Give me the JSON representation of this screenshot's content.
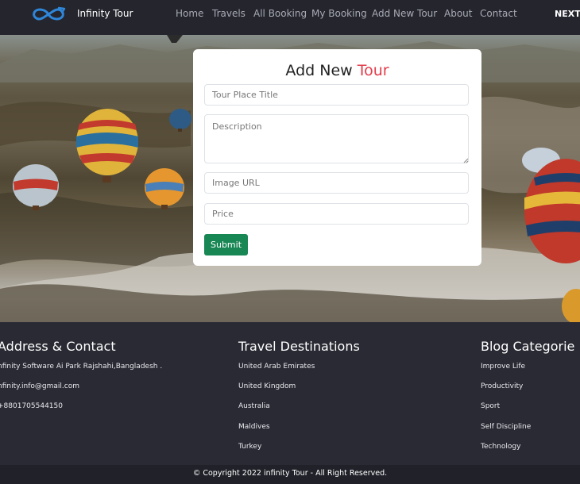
{
  "navbar": {
    "brand": "Infinity Tour",
    "links": [
      "Home",
      "Travels",
      "All Booking",
      "My Booking",
      "Add New Tour",
      "About",
      "Contact"
    ],
    "next_label": "NEXT C"
  },
  "form": {
    "title_main": "Add New ",
    "title_accent": "Tour",
    "tour_place_placeholder": "Tour Place Title",
    "description_placeholder": "Description",
    "image_url_placeholder": "Image URL",
    "price_placeholder": "Price",
    "submit_label": "Submit"
  },
  "footer": {
    "address": {
      "heading": "Address & Contact",
      "items": [
        "nfinity Software Ai Park Rajshahi,Bangladesh .",
        "nfinity.info@gmail.com",
        "+8801705544150"
      ]
    },
    "destinations": {
      "heading": "Travel Destinations",
      "items": [
        "United Arab Emirates",
        "United Kingdom",
        "Australia",
        "Maldives",
        "Turkey"
      ]
    },
    "blog": {
      "heading": "Blog Categorie",
      "items": [
        "Improve Life",
        "Productivity",
        "Sport",
        "Self Discipline",
        "Technology"
      ]
    },
    "copyright": "© Copyright 2022 infinity Tour - All Right Reserved."
  },
  "colors": {
    "accent": "#e33c4a",
    "submit": "#198754",
    "dark_bg": "#24252d",
    "footer_bg": "#292a33"
  },
  "icons": {
    "logo": "infinity-logo-icon"
  }
}
